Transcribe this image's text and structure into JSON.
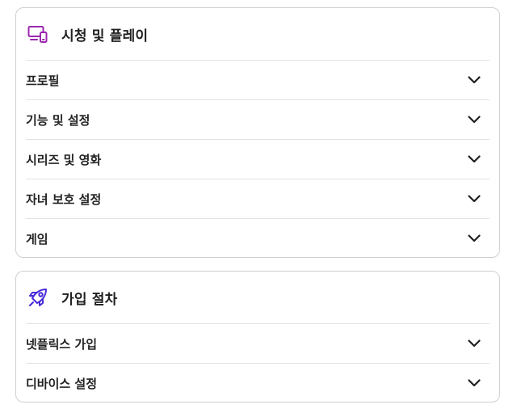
{
  "sections": [
    {
      "title": "시청 및 플레이",
      "icon": "devices-icon",
      "accent_color": "#9c27b0",
      "items": [
        {
          "label": "프로필"
        },
        {
          "label": "기능 및 설정"
        },
        {
          "label": "시리즈 및 영화"
        },
        {
          "label": "자녀 보호 설정"
        },
        {
          "label": "게임"
        }
      ]
    },
    {
      "title": "가입 절차",
      "icon": "rocket-icon",
      "accent_color": "#4a2bd8",
      "items": [
        {
          "label": "넷플릭스 가입"
        },
        {
          "label": "디바이스 설정"
        }
      ]
    }
  ],
  "chevron_icon": "chevron-down-icon"
}
